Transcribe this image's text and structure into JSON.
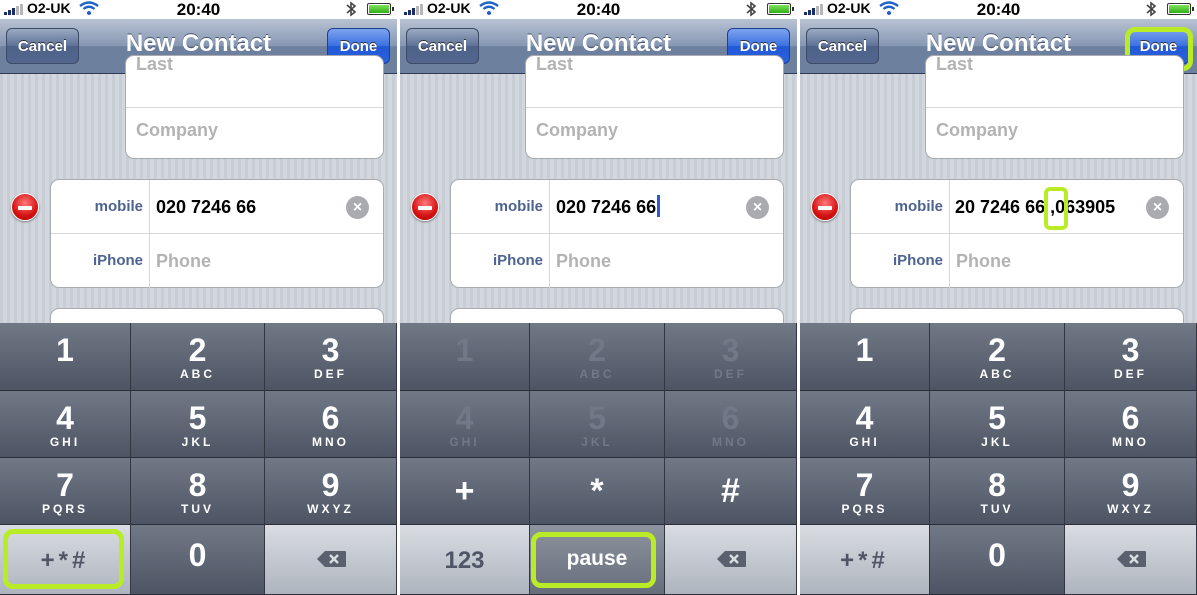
{
  "status": {
    "carrier": "O2-UK",
    "time": "20:40"
  },
  "nav": {
    "cancel": "Cancel",
    "title": "New Contact",
    "done": "Done"
  },
  "form": {
    "last_placeholder": "Last",
    "company_placeholder": "Company",
    "mobile_label": "mobile",
    "iphone_label": "iPhone",
    "phone_placeholder": "Phone",
    "clear_glyph": "×"
  },
  "panels": [
    {
      "mobile_value": "020 7246 66"
    },
    {
      "mobile_value": "020 7246 66"
    },
    {
      "mobile_value": "20 7246 66 ",
      "pause_char": ",",
      "mobile_suffix": "063905"
    }
  ],
  "keypad": {
    "digits": [
      {
        "d": "1",
        "l": ""
      },
      {
        "d": "2",
        "l": "ABC"
      },
      {
        "d": "3",
        "l": "DEF"
      },
      {
        "d": "4",
        "l": "GHI"
      },
      {
        "d": "5",
        "l": "JKL"
      },
      {
        "d": "6",
        "l": "MNO"
      },
      {
        "d": "7",
        "l": "PQRS"
      },
      {
        "d": "8",
        "l": "TUV"
      },
      {
        "d": "9",
        "l": "WXYZ"
      },
      {
        "d": "0",
        "l": ""
      }
    ],
    "symbols_key": "+*#",
    "plus": "+",
    "star": "*",
    "hash": "#",
    "abc_key": "123",
    "pause_key": "pause"
  },
  "highlight_color": "#b9ec27"
}
